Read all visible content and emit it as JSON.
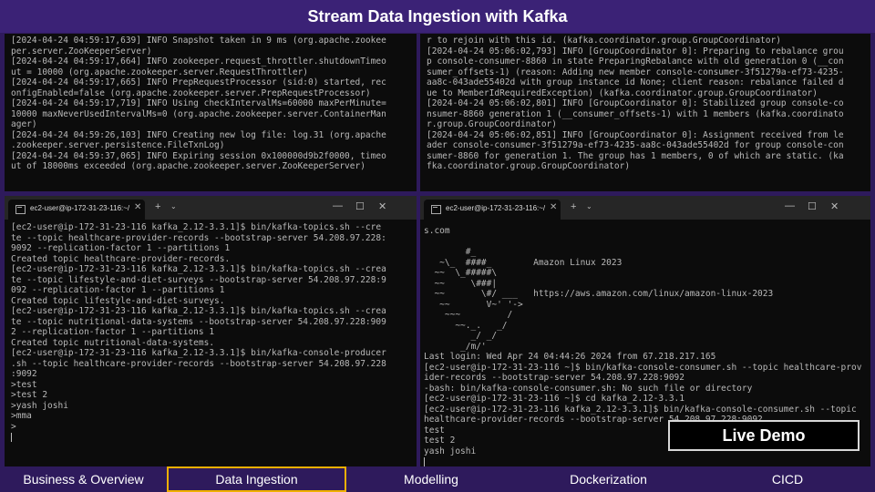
{
  "title": "Stream Data Ingestion with Kafka",
  "badge": "Live Demo",
  "nav": [
    "Business & Overview",
    "Data Ingestion",
    "Modelling",
    "Dockerization",
    "CICD"
  ],
  "pane_top_left": [
    "[2024-04-24 04:59:17,639] INFO Snapshot taken in 9 ms (org.apache.zookee",
    "per.server.ZooKeeperServer)",
    "[2024-04-24 04:59:17,664] INFO zookeeper.request_throttler.shutdownTimeo",
    "ut = 10000 (org.apache.zookeeper.server.RequestThrottler)",
    "[2024-04-24 04:59:17,665] INFO PrepRequestProcessor (sid:0) started, rec",
    "onfigEnabled=false (org.apache.zookeeper.server.PrepRequestProcessor)",
    "[2024-04-24 04:59:17,719] INFO Using checkIntervalMs=60000 maxPerMinute=",
    "10000 maxNeverUsedIntervalMs=0 (org.apache.zookeeper.server.ContainerMan",
    "ager)",
    "[2024-04-24 04:59:26,103] INFO Creating new log file: log.31 (org.apache",
    ".zookeeper.server.persistence.FileTxnLog)",
    "[2024-04-24 04:59:37,065] INFO Expiring session 0x100000d9b2f0000, timeo",
    "ut of 18000ms exceeded (org.apache.zookeeper.server.ZooKeeperServer)"
  ],
  "pane_top_right": [
    "r to rejoin with this id. (kafka.coordinator.group.GroupCoordinator)",
    "[2024-04-24 05:06:02,793] INFO [GroupCoordinator 0]: Preparing to rebalance grou",
    "p console-consumer-8860 in state PreparingRebalance with old generation 0 (__con",
    "sumer_offsets-1) (reason: Adding new member console-consumer-3f51279a-ef73-4235-",
    "aa8c-043ade55402d with group instance id None; client reason: rebalance failed d",
    "ue to MemberIdRequiredException) (kafka.coordinator.group.GroupCoordinator)",
    "[2024-04-24 05:06:02,801] INFO [GroupCoordinator 0]: Stabilized group console-co",
    "nsumer-8860 generation 1 (__consumer_offsets-1) with 1 members (kafka.coordinato",
    "r.group.GroupCoordinator)",
    "[2024-04-24 05:06:02,851] INFO [GroupCoordinator 0]: Assignment received from le",
    "ader console-consumer-3f51279a-ef73-4235-aa8c-043ade55402d for group console-con",
    "sumer-8860 for generation 1. The group has 1 members, 0 of which are static. (ka",
    "fka.coordinator.group.GroupCoordinator)"
  ],
  "tab_bl": "ec2-user@ip-172-31-23-116:~/",
  "tab_br": "ec2-user@ip-172-31-23-116:~/",
  "pane_bottom_left": [
    "[ec2-user@ip-172-31-23-116 kafka_2.12-3.3.1]$ bin/kafka-topics.sh --cre",
    "te --topic healthcare-provider-records --bootstrap-server 54.208.97.228:",
    "9092 --replication-factor 1 --partitions 1",
    "Created topic healthcare-provider-records.",
    "[ec2-user@ip-172-31-23-116 kafka_2.12-3.3.1]$ bin/kafka-topics.sh --crea",
    "te --topic lifestyle-and-diet-surveys --bootstrap-server 54.208.97.228:9",
    "092 --replication-factor 1 --partitions 1",
    "Created topic lifestyle-and-diet-surveys.",
    "[ec2-user@ip-172-31-23-116 kafka_2.12-3.3.1]$ bin/kafka-topics.sh --crea",
    "te --topic nutritional-data-systems --bootstrap-server 54.208.97.228:909",
    "2 --replication-factor 1 --partitions 1",
    "Created topic nutritional-data-systems.",
    "[ec2-user@ip-172-31-23-116 kafka_2.12-3.3.1]$ bin/kafka-console-producer",
    ".sh --topic healthcare-provider-records --bootstrap-server 54.208.97.228",
    ":9092",
    ">test",
    ">test 2",
    ">yash joshi",
    ">mma",
    ">"
  ],
  "pane_bottom_right": [
    "s.com",
    "",
    "        #_",
    "   ~\\_  ####_        Amazon Linux 2023",
    "  ~~  \\_#####\\",
    "  ~~     \\###|",
    "  ~~       \\#/ ___   https://aws.amazon.com/linux/amazon-linux-2023",
    "   ~~       V~' '->",
    "    ~~~         /",
    "      ~~._.   _/",
    "         _/ _/",
    "       _/m/'",
    "Last login: Wed Apr 24 04:44:26 2024 from 67.218.217.165",
    "[ec2-user@ip-172-31-23-116 ~]$ bin/kafka-console-consumer.sh --topic healthcare-prov",
    "ider-records --bootstrap-server 54.208.97.228:9092",
    "-bash: bin/kafka-console-consumer.sh: No such file or directory",
    "[ec2-user@ip-172-31-23-116 ~]$ cd kafka_2.12-3.3.1",
    "[ec2-user@ip-172-31-23-116 kafka_2.12-3.3.1]$ bin/kafka-console-consumer.sh --topic",
    "healthcare-provider-records --bootstrap-server 54.208.97.228:9092",
    "test",
    "test 2",
    "yash joshi"
  ]
}
